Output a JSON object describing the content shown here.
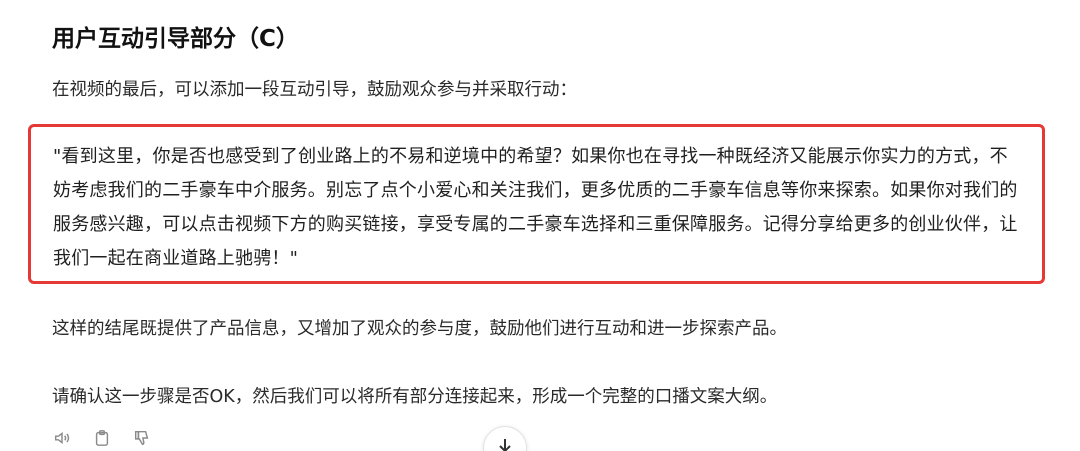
{
  "section": {
    "title": "用户互动引导部分（C）"
  },
  "intro": {
    "text": "在视频的最后，可以添加一段互动引导，鼓励观众参与并采取行动："
  },
  "quote": {
    "text": "\"看到这里，你是否也感受到了创业路上的不易和逆境中的希望？如果你也在寻找一种既经济又能展示你实力的方式，不妨考虑我们的二手豪车中介服务。别忘了点个小爱心和关注我们，更多优质的二手豪车信息等你来探索。如果你对我们的服务感兴趣，可以点击视频下方的购买链接，享受专属的二手豪车选择和三重保障服务。记得分享给更多的创业伙伴，让我们一起在商业道路上驰骋！\"",
    "highlight_color": "#e53935"
  },
  "summary": {
    "text": "这样的结尾既提供了产品信息，又增加了观众的参与度，鼓励他们进行互动和进一步探索产品。"
  },
  "confirm": {
    "text": "请确认这一步骤是否OK，然后我们可以将所有部分连接起来，形成一个完整的口播文案大纲。"
  },
  "actions": {
    "icons": [
      "speaker-icon",
      "clipboard-icon",
      "thumbs-down-icon",
      "arrow-down-icon"
    ]
  }
}
